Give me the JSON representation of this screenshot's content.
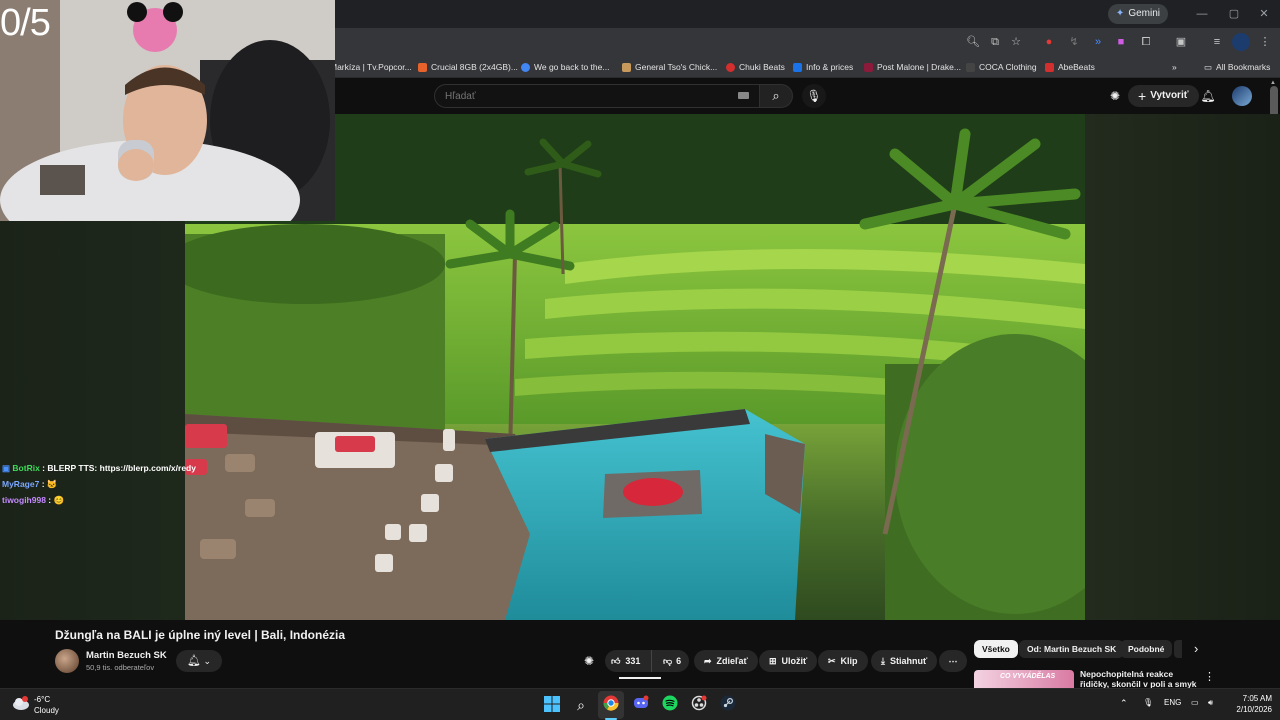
{
  "browser": {
    "gemini_label": "Gemini",
    "bookmarks": [
      {
        "label": "Markíza | Tv.Popcor...",
        "color": "#f0f0f0"
      },
      {
        "label": "Crucial 8GB (2x4GB)...",
        "color": "#e8622c"
      },
      {
        "label": "We go back to the...",
        "color": "#4285f4"
      },
      {
        "label": "General Tso's Chick...",
        "color": "#c79a5b"
      },
      {
        "label": "Chuki Beats",
        "color": "#d32f2f"
      },
      {
        "label": "Info & prices",
        "color": "#1a73e8"
      },
      {
        "label": "Post Malone | Drake...",
        "color": "#8b1a3b"
      },
      {
        "label": "COCA Clothing",
        "color": "#222222"
      },
      {
        "label": "AbeBeats",
        "color": "#d32f2f"
      }
    ],
    "all_bookmarks_label": "All Bookmarks"
  },
  "youtube": {
    "search_placeholder": "Hľadať",
    "create_label": "Vytvoriť",
    "video_title": "Džungľa na BALI je úplne iný level | Bali, Indonézia",
    "channel_name": "Martin Bezuch SK",
    "subscribers": "50,9 tis. odberateľov",
    "likes": "331",
    "dislikes": "6",
    "actions": {
      "share": "Zdieľať",
      "save": "Uložiť",
      "clip": "Klip",
      "download": "Stiahnuť"
    },
    "chips": [
      "Všetko",
      "Od: Martin Bezuch SK",
      "Podobné"
    ],
    "recommendation": {
      "thumb_text": "CO VYVÁDĚLAS",
      "title": "Nepochopitelná reakce řidičky, skončil v poli a smyk na ledový"
    }
  },
  "stream_overlay": {
    "counter": "0/5",
    "chat": [
      {
        "user": "BotRix",
        "user_color": "#3ddc5a",
        "message": "BLERP TTS: https://blerp.com/x/redy"
      },
      {
        "user": "MyRage7",
        "user_color": "#7aa7ff",
        "message": "🐱"
      },
      {
        "user": "tiwogih998",
        "user_color": "#c48aff",
        "message": "😊"
      }
    ]
  },
  "taskbar": {
    "temperature": "-6°C",
    "weather": "Cloudy",
    "language": "ENG",
    "time": "7:05 AM",
    "date": "2/10/2026"
  },
  "colors": {
    "youtube_bg": "#0f0f0f",
    "chrome_toolbar": "#35363a",
    "taskbar": "#202020",
    "pool": "#37b6c6"
  }
}
